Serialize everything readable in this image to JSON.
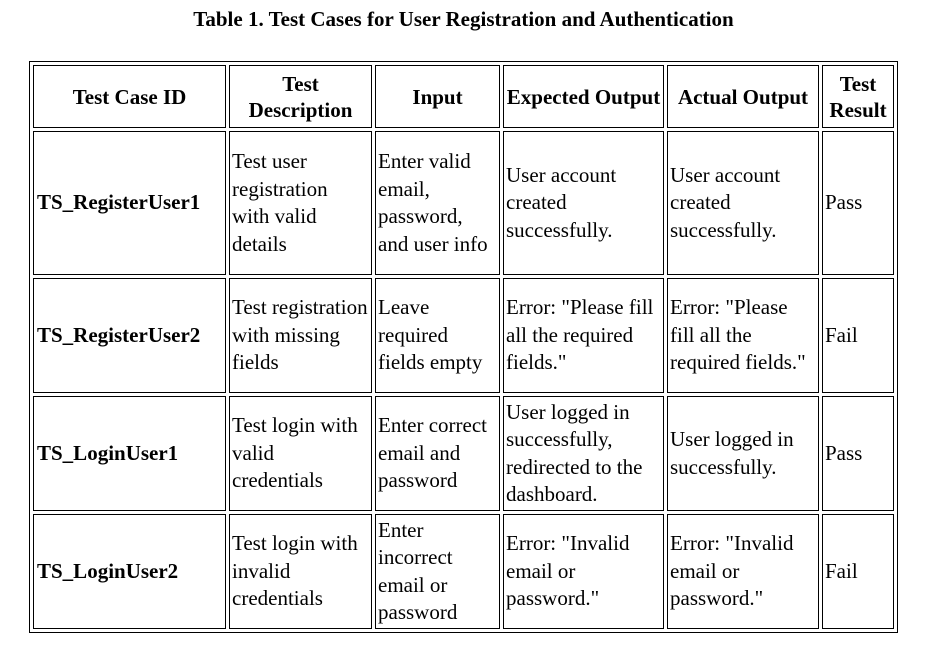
{
  "title": "Table 1. Test Cases for User Registration and Authentication",
  "headers": [
    "Test Case ID",
    "Test Description",
    "Input",
    "Expected Output",
    "Actual Output",
    "Test Result"
  ],
  "rows": [
    {
      "id": "TS_RegisterUser1",
      "description": "Test user registration with valid details",
      "input": "Enter valid email, password, and user info",
      "expected": "User account created successfully.",
      "actual": "User account created successfully.",
      "result": "Pass"
    },
    {
      "id": "TS_RegisterUser2",
      "description": "Test registration with missing fields",
      "input": "Leave required fields empty",
      "expected": "Error: \"Please fill all the required fields.\"",
      "actual": "Error: \"Please fill all the required fields.\"",
      "result": "Fail"
    },
    {
      "id": "TS_LoginUser1",
      "description": "Test login with valid credentials",
      "input": "Enter correct email and password",
      "expected": "User logged in successfully, redirected to the dashboard.",
      "actual": "User logged in successfully.",
      "result": "Pass"
    },
    {
      "id": "TS_LoginUser2",
      "description": "Test login with invalid credentials",
      "input": "Enter incorrect email or password",
      "expected": "Error: \"Invalid email or password.\"",
      "actual": "Error: \"Invalid email or password.\"",
      "result": "Fail"
    }
  ]
}
